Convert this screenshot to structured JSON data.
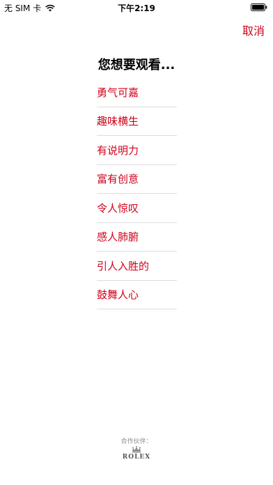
{
  "status_bar": {
    "carrier": "无 SIM 卡",
    "time": "下午2:19",
    "wifi_icon": "wifi-icon",
    "battery_icon": "battery-icon"
  },
  "header": {
    "cancel_label": "取消"
  },
  "prompt": {
    "title": "您想要观看..."
  },
  "options": [
    {
      "label": "勇气可嘉"
    },
    {
      "label": "趣味横生"
    },
    {
      "label": "有说明力"
    },
    {
      "label": "富有创意"
    },
    {
      "label": "令人惊叹"
    },
    {
      "label": "感人肺腑"
    },
    {
      "label": "引人入胜的"
    },
    {
      "label": "鼓舞人心"
    }
  ],
  "footer": {
    "partner_label": "合作伙伴：",
    "partner_logo": "ROLEX"
  },
  "colors": {
    "accent": "#d0021b",
    "divider": "#dcdcdc",
    "muted_text": "#8e8e8e"
  }
}
